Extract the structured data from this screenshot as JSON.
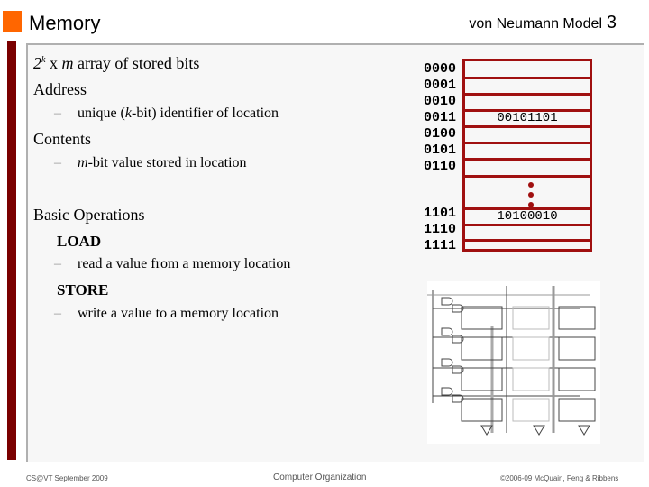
{
  "header": {
    "title": "Memory",
    "subtitle": "von Neumann Model",
    "page_number": "3"
  },
  "body": {
    "line1_prefix": "2",
    "line1_sup": "k",
    "line1_x": " x ",
    "line1_m": "m",
    "line1_rest": " array of stored bits",
    "address_heading": "Address",
    "address_sub_pre": "unique (",
    "address_sub_k": "k",
    "address_sub_post": "-bit) identifier of location",
    "contents_heading": "Contents",
    "contents_sub_m": "m",
    "contents_sub_post": "-bit value stored in location",
    "ops_heading": "Basic Operations",
    "load_label": "LOAD",
    "load_desc": "read a value from a memory location",
    "store_label": "STORE",
    "store_desc": "write a value to a memory location",
    "dash": "–"
  },
  "memory_diagram": {
    "addresses": [
      "0000",
      "0001",
      "0010",
      "0011",
      "0100",
      "0101",
      "0110",
      "1101",
      "1110",
      "1111"
    ],
    "cells": [
      "",
      "",
      "",
      "00101101",
      "",
      "",
      "",
      "10100010",
      "",
      ""
    ],
    "ellipsis": "vertical-dots",
    "border_color": "#a01010"
  },
  "circuit_image": {
    "label": "memory-circuit-diagram"
  },
  "footer": {
    "left": "CS@VT September 2009",
    "center": "Computer Organization I",
    "right": "©2006-09  McQuain, Feng & Ribbens"
  },
  "colors": {
    "accent_orange": "#ff6600",
    "sidebar_red": "#7a0000",
    "memory_red": "#a01010"
  }
}
